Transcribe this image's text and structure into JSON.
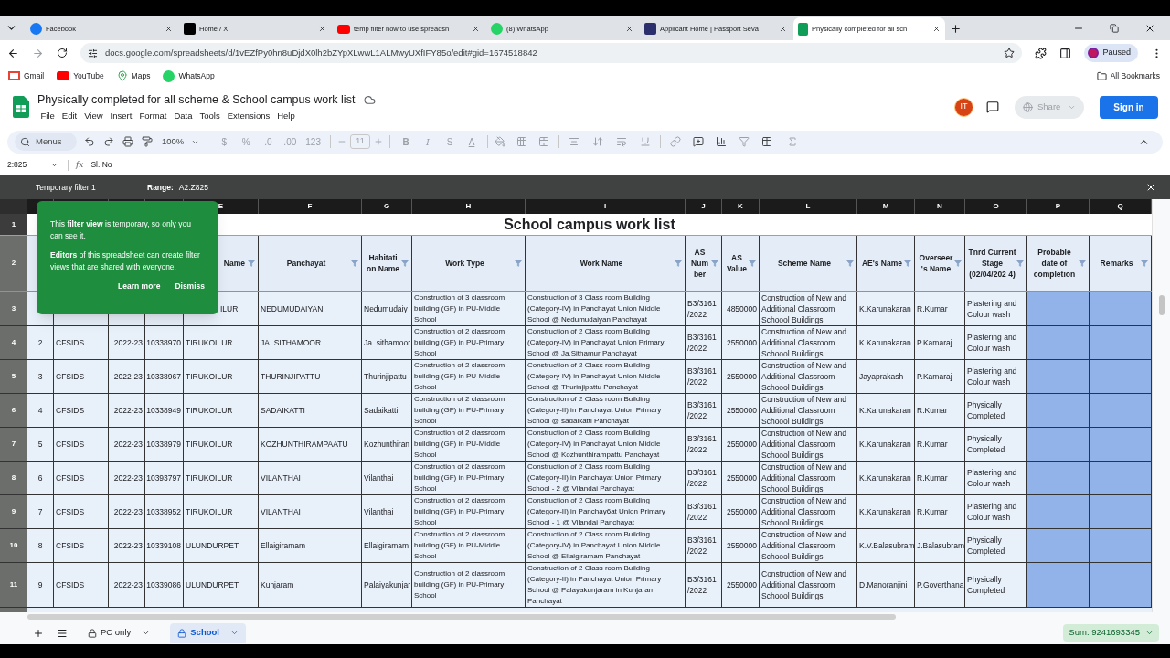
{
  "browser": {
    "tabs": [
      {
        "title": "Facebook",
        "kind": "facebook",
        "selected": false
      },
      {
        "title": "Home / X",
        "kind": "x",
        "selected": false
      },
      {
        "title": "temp filter how to use spreadsh",
        "kind": "youtube",
        "selected": false
      },
      {
        "title": "(8) WhatsApp",
        "kind": "whatsapp",
        "selected": false
      },
      {
        "title": "Applicant Home | Passport Seva",
        "kind": "passport",
        "selected": false
      },
      {
        "title": "Physically completed for all sch",
        "kind": "sheets",
        "selected": true
      }
    ],
    "url": "docs.google.com/spreadsheets/d/1vEZfPy0hn8uDjdX0lh2bZYpXLwwL1ALMwyUXfIFY85o/edit#gid=1674518842",
    "profile": "Paused",
    "bookmarks": [
      {
        "label": "Gmail",
        "kind": "gmail"
      },
      {
        "label": "YouTube",
        "kind": "youtube"
      },
      {
        "label": "Maps",
        "kind": "maps"
      },
      {
        "label": "WhatsApp",
        "kind": "whatsapp"
      }
    ],
    "all_bookmarks": "All Bookmarks"
  },
  "doc": {
    "title": "Physically completed for all scheme & School campus work list",
    "menu": [
      "File",
      "Edit",
      "View",
      "Insert",
      "Format",
      "Data",
      "Tools",
      "Extensions",
      "Help"
    ],
    "avatar": "IT",
    "share": "Share",
    "sign_in": "Sign in"
  },
  "toolbar": {
    "search": "Menus",
    "zoom": "100%",
    "currency": "$",
    "percent": "%",
    "decimal_decrease": ".0",
    "decimal_increase": ".00",
    "number_format": "123",
    "font_size": "11",
    "bold": "B",
    "italic": "I",
    "strikethrough": "S",
    "text_color": "A"
  },
  "formula_bar": {
    "cell": "2:825",
    "fx": "fx",
    "content": "Sl. No"
  },
  "filter_bar": {
    "name": "Temporary filter 1",
    "range_label": "Range:",
    "range": "A2:Z825"
  },
  "popover": {
    "paragraphs": [
      "This **filter view** is temporary, so only you can see it.",
      "**Editors** of this spreadsheet can create filter views that are shared with everyone."
    ],
    "actions": [
      "Learn more",
      "Dismiss"
    ]
  },
  "sheet": {
    "title": "School campus work list",
    "columns": [
      {
        "letter": "E",
        "header": "Name"
      },
      {
        "letter": "F",
        "header": "Panchayat"
      },
      {
        "letter": "G",
        "header": "Habitati on Name"
      },
      {
        "letter": "H",
        "header": "Work Type"
      },
      {
        "letter": "I",
        "header": "Work Name"
      },
      {
        "letter": "J",
        "header": "AS Num ber"
      },
      {
        "letter": "K",
        "header": "AS Value"
      },
      {
        "letter": "L",
        "header": "Scheme Name"
      },
      {
        "letter": "M",
        "header": "AE's Name"
      },
      {
        "letter": "N",
        "header": "Overseer 's Name"
      },
      {
        "letter": "O",
        "header": "Tnrd Current Stage (02/04/202 4)"
      },
      {
        "letter": "P",
        "header": "Probable date of completion"
      },
      {
        "letter": "Q",
        "header": "Remarks"
      }
    ],
    "title_row": "1",
    "header_row": "2",
    "rows": [
      {
        "number": "3",
        "cells": [
          "ILUR",
          "NEDUMUDAIYAN",
          "Nedumudaiy",
          "Construction of 3 classroom building (GF) in PU-Middle School",
          "Construction of 3 Class room Building (Category-IV) in Panchayat Union Middle School @ Nedumudaiyan Panchayat",
          "B3/3161 /2022",
          "4850000",
          "Construction of New and Additional Classroom Schoool Buildings",
          "K.Karunakaran",
          "R.Kumar",
          "Plastering and Colour wash"
        ]
      },
      {
        "number": "4",
        "cells": [
          "2",
          "CFSIDS",
          "2022-23",
          "10338970",
          "TIRUKOILUR",
          "JA. SITHAMOOR",
          "Ja. sithamoor",
          "Construction of 2 classroom building (GF) in PU-Primary School",
          "Construction of 2 Class room Building (Category-IV) in Panchayat Union Primary School @ Ja.Sithamur Panchayat",
          "B3/3161 /2022",
          "2550000",
          "Construction of New and Additional Classroom Schoool Buildings",
          "K.Karunakaran",
          "P.Kamaraj",
          "Plastering and Colour wash"
        ]
      },
      {
        "number": "5",
        "cells": [
          "3",
          "CFSIDS",
          "2022-23",
          "10338967",
          "TIRUKOILUR",
          "THURINJIPATTU",
          "Thurinjipattu",
          "Construction of 2 classroom building (GF) in PU-Middle School",
          "Construction of 2 Class room Building (Category-IV) in Panchayat Union Middle School @ Thurinjipattu Panchayat",
          "B3/3161 /2022",
          "2550000",
          "Construction of New and Additional Classroom Schoool Buildings",
          "Jayaprakash",
          "P.Kamaraj",
          "Plastering and Colour wash"
        ]
      },
      {
        "number": "6",
        "cells": [
          "4",
          "CFSIDS",
          "2022-23",
          "10338949",
          "TIRUKOILUR",
          "SADAIKATTI",
          "Sadaikatti",
          "Construction of 2 classroom building (GF) in PU-Primary School",
          "Construction of 2 Class room Building (Category-II) in Panchayat Union Primary School @ sadaikatti Panchayat",
          "B3/3161 /2022",
          "2550000",
          "Construction of New and Additional Classroom Schoool Buildings",
          "K.Karunakaran",
          "R.Kumar",
          "Physically Completed"
        ]
      },
      {
        "number": "7",
        "cells": [
          "5",
          "CFSIDS",
          "2022-23",
          "10338979",
          "TIRUKOILUR",
          "KOZHUNTHIRAMPAATU",
          "Kozhunthiran",
          "Construction of 2 classroom building (GF) in PU-Middle School",
          "Construction of 2 Class room Building (Category-IV) in Panchayat Union Middle School @ Kozhunthirampattu Panchayat",
          "B3/3161 /2022",
          "2550000",
          "Construction of New and Additional Classroom Schoool Buildings",
          "K.Karunakaran",
          "R.Kumar",
          "Physically Completed"
        ]
      },
      {
        "number": "8",
        "cells": [
          "6",
          "CFSIDS",
          "2022-23",
          "10393797",
          "TIRUKOILUR",
          "VILANTHAI",
          "Vilanthai",
          "Construction of 2 classroom building (GF) in PU-Primary School",
          "Construction of 2 Class room Building (Category-II) in Panchayat Union Primary School - 2 @ Vilandai Panchayat",
          "B3/3161 /2022",
          "2550000",
          "Construction of New and Additional Classroom Schoool Buildings",
          "K.Karunakaran",
          "R.Kumar",
          "Plastering and Colour wash"
        ]
      },
      {
        "number": "9",
        "cells": [
          "7",
          "CFSIDS",
          "2022-23",
          "10338952",
          "TIRUKOILUR",
          "VILANTHAI",
          "Vilanthai",
          "Construction of 2 classroom building (GF) in PU-Primary School",
          "Construction of 2 Class room Building (Category-II) in Panchay6at Union Primary School - 1 @ Vilandai Panchayat",
          "B3/3161 /2022",
          "2550000",
          "Construction of New and Additional Classroom Schoool Buildings",
          "K.Karunakaran",
          "R.Kumar",
          "Plastering and Colour wash"
        ]
      },
      {
        "number": "10",
        "cells": [
          "8",
          "CFSIDS",
          "2022-23",
          "10339108",
          "ULUNDURPET",
          "Ellaigiramam",
          "Ellaigiramam",
          "Construction of 2 classroom building (GF) in PU-Middle School",
          "Construction of 2 Class room Building (Category-IV) in Panchayat Union Middle School @ Ellaigiramam Panchayat",
          "B3/3161 /2022",
          "2550000",
          "Construction of New and Additional Classroom Schoool Buildings",
          "K.V.Balasubram",
          "J.Balasubram",
          "Physically Completed"
        ]
      },
      {
        "number": "11",
        "cells": [
          "9",
          "CFSIDS",
          "2022-23",
          "10339086",
          "ULUNDURPET",
          "Kunjaram",
          "Palaiyakunjar",
          "Construction of 2 classroom building (GF) in PU-Primary School",
          "Construction of 2 Class room Building (Category-II) in Panchayat Union Primary School @ Palayakunjaram in Kunjaram Panchayat",
          "B3/3161 /2022",
          "2550000",
          "Construction of New and Additional Classroom Schoool Buildings",
          "D.Manoranjini",
          "P.Goverthana",
          "Physically Completed"
        ]
      }
    ]
  },
  "bottom_bar": {
    "sheets": [
      {
        "name": "PC only",
        "locked": true,
        "selected": false
      },
      {
        "name": "School",
        "locked": true,
        "selected": true
      }
    ],
    "sum": "Sum: 9241693345"
  }
}
